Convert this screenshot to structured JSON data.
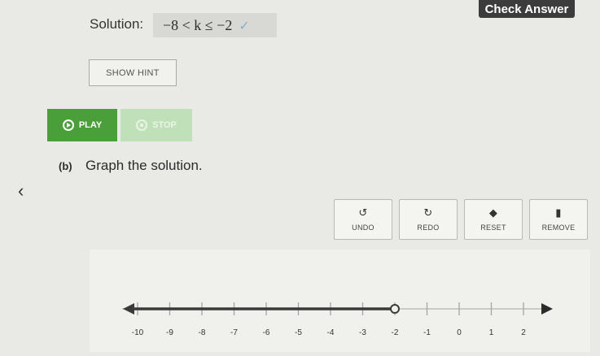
{
  "header": {
    "check_answer": "Check Answer"
  },
  "solution": {
    "label": "Solution:",
    "value": "−8 < k ≤ −2",
    "check": "✓"
  },
  "hint": {
    "label": "SHOW HINT"
  },
  "media": {
    "play": "PLAY",
    "stop": "STOP"
  },
  "part_b": {
    "label": "(b)",
    "text": "Graph the solution."
  },
  "nav": {
    "back": "‹"
  },
  "tools": [
    {
      "label": "UNDO",
      "icon": "↺",
      "icon_name": "undo-icon"
    },
    {
      "label": "REDO",
      "icon": "↻",
      "icon_name": "redo-icon"
    },
    {
      "label": "RESET",
      "icon": "◆",
      "icon_name": "eraser-icon"
    },
    {
      "label": "REMOVE",
      "icon": "▮",
      "icon_name": "trash-icon"
    }
  ],
  "number_line": {
    "ticks": [
      "-10",
      "-9",
      "-8",
      "-7",
      "-6",
      "-5",
      "-4",
      "-3",
      "-2",
      "-1",
      "0",
      "1",
      "2"
    ],
    "shaded_from": -10,
    "shaded_to": -2,
    "right_endpoint": "open",
    "shaded_color": "#3a3a3a"
  }
}
